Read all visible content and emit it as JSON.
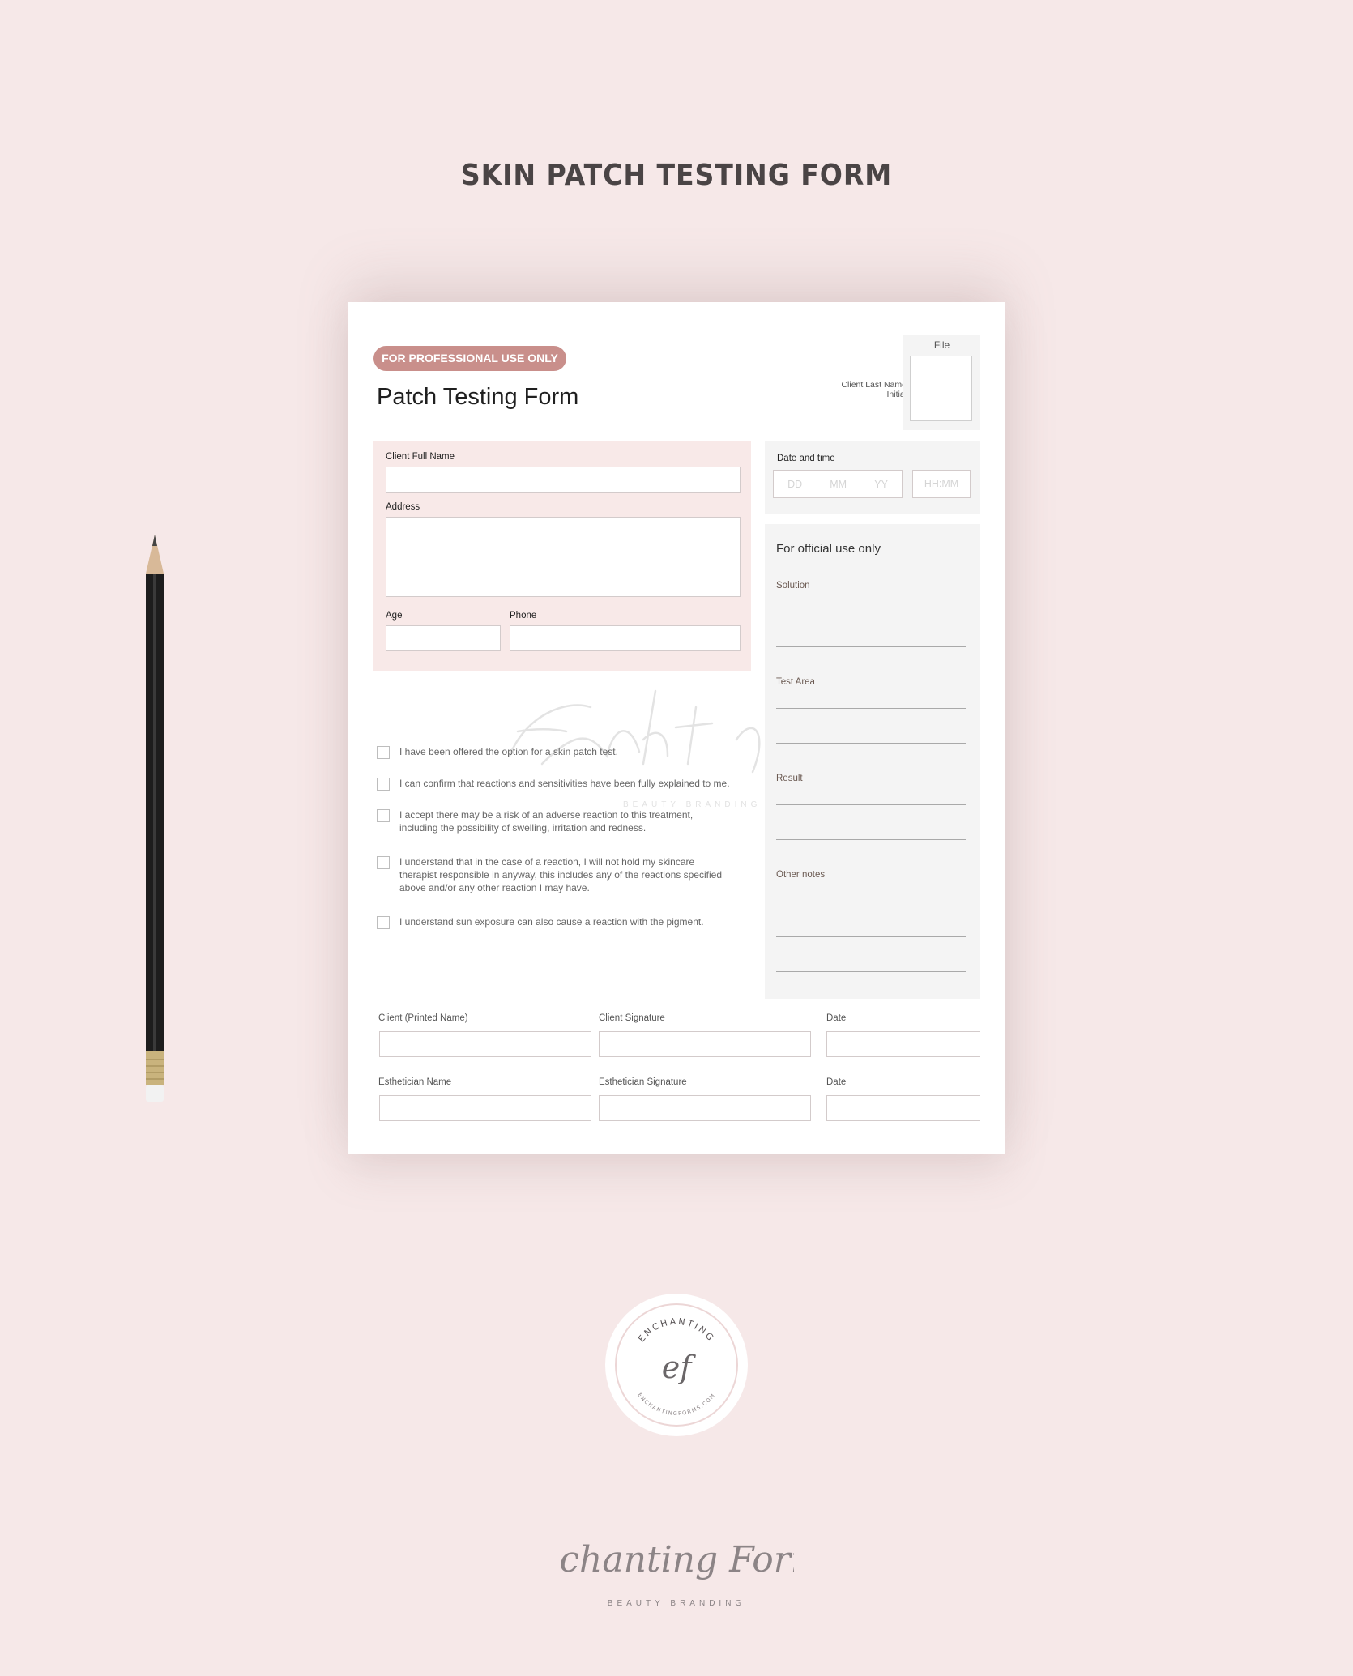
{
  "page_title": "SKIN PATCH TESTING FORM",
  "form": {
    "badge": "FOR PROFESSIONAL USE ONLY",
    "title": "Patch Testing Form",
    "client_last_initial_label": "Client Last Name Initial",
    "file_label": "File",
    "client_info": {
      "full_name_label": "Client Full Name",
      "full_name_value": "",
      "address_label": "Address",
      "address_value": "",
      "age_label": "Age",
      "age_value": "",
      "phone_label": "Phone",
      "phone_value": ""
    },
    "date_time": {
      "label": "Date and time",
      "dd_placeholder": "DD",
      "mm_placeholder": "MM",
      "yy_placeholder": "YY",
      "time_placeholder": "HH:MM"
    },
    "official_use": {
      "title": "For official use only",
      "sections": [
        {
          "label": "Solution"
        },
        {
          "label": "Test Area"
        },
        {
          "label": "Result"
        },
        {
          "label": "Other notes"
        }
      ]
    },
    "consents": [
      {
        "text": "I have been offered the option for a skin patch test.",
        "checked": false
      },
      {
        "text": "I can confirm that reactions and sensitivities have been fully explained to me.",
        "checked": false
      },
      {
        "text": "I accept there may be a risk of an adverse reaction to this treatment, including the possibility of swelling, irritation and redness.",
        "checked": false
      },
      {
        "text": "I understand that in the case of a reaction, I will not hold my skincare therapist responsible in anyway, this includes any of the reactions specified above and/or any other reaction I may have.",
        "checked": false
      },
      {
        "text": "I understand sun exposure can also cause a reaction with the pigment.",
        "checked": false
      }
    ],
    "signatures": {
      "client_printed_name": "Client (Printed Name)",
      "client_signature": "Client Signature",
      "client_date": "Date",
      "esthetician_name": "Esthetician Name",
      "esthetician_signature": "Esthetician Signature",
      "esthetician_date": "Date"
    },
    "watermark": {
      "script": "Enchanting Forms",
      "sub": "BEAUTY BRANDING"
    }
  },
  "logo_badge": {
    "top_text": "ENCHANTING",
    "monogram": "ef",
    "bottom_text": "ENCHANTINGFORMS.COM"
  },
  "brand": {
    "script": "Enchanting Forms",
    "tagline": "BEAUTY BRANDING"
  },
  "colors": {
    "background": "#f6e8e8",
    "badge": "#c98f8b",
    "client_panel": "#f8e9e8",
    "official_panel": "#f4f4f4",
    "title_text": "#4a4445"
  }
}
